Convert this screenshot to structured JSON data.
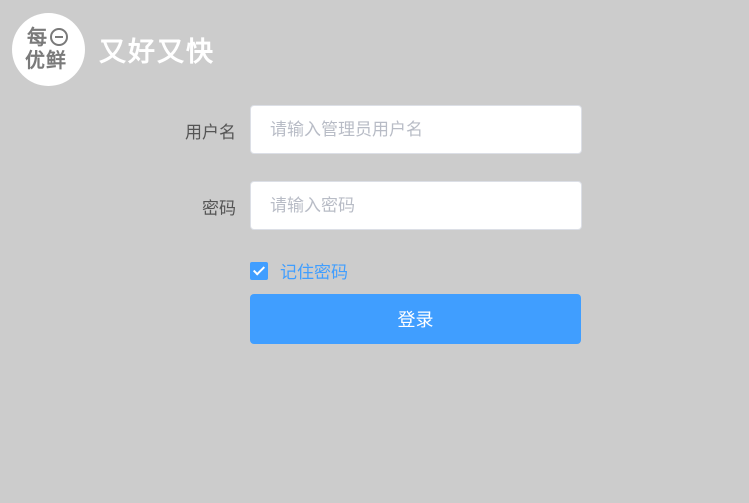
{
  "brand": {
    "logo_top": "每",
    "logo_bottom": "优鲜",
    "slogan": "又好又快"
  },
  "form": {
    "username": {
      "label": "用户名",
      "placeholder": "请输入管理员用户名",
      "value": ""
    },
    "password": {
      "label": "密码",
      "placeholder": "请输入密码",
      "value": ""
    },
    "remember": {
      "label": "记住密码",
      "checked": true
    },
    "submit_label": "登录"
  },
  "colors": {
    "background": "#cccccc",
    "accent": "#409eff"
  }
}
